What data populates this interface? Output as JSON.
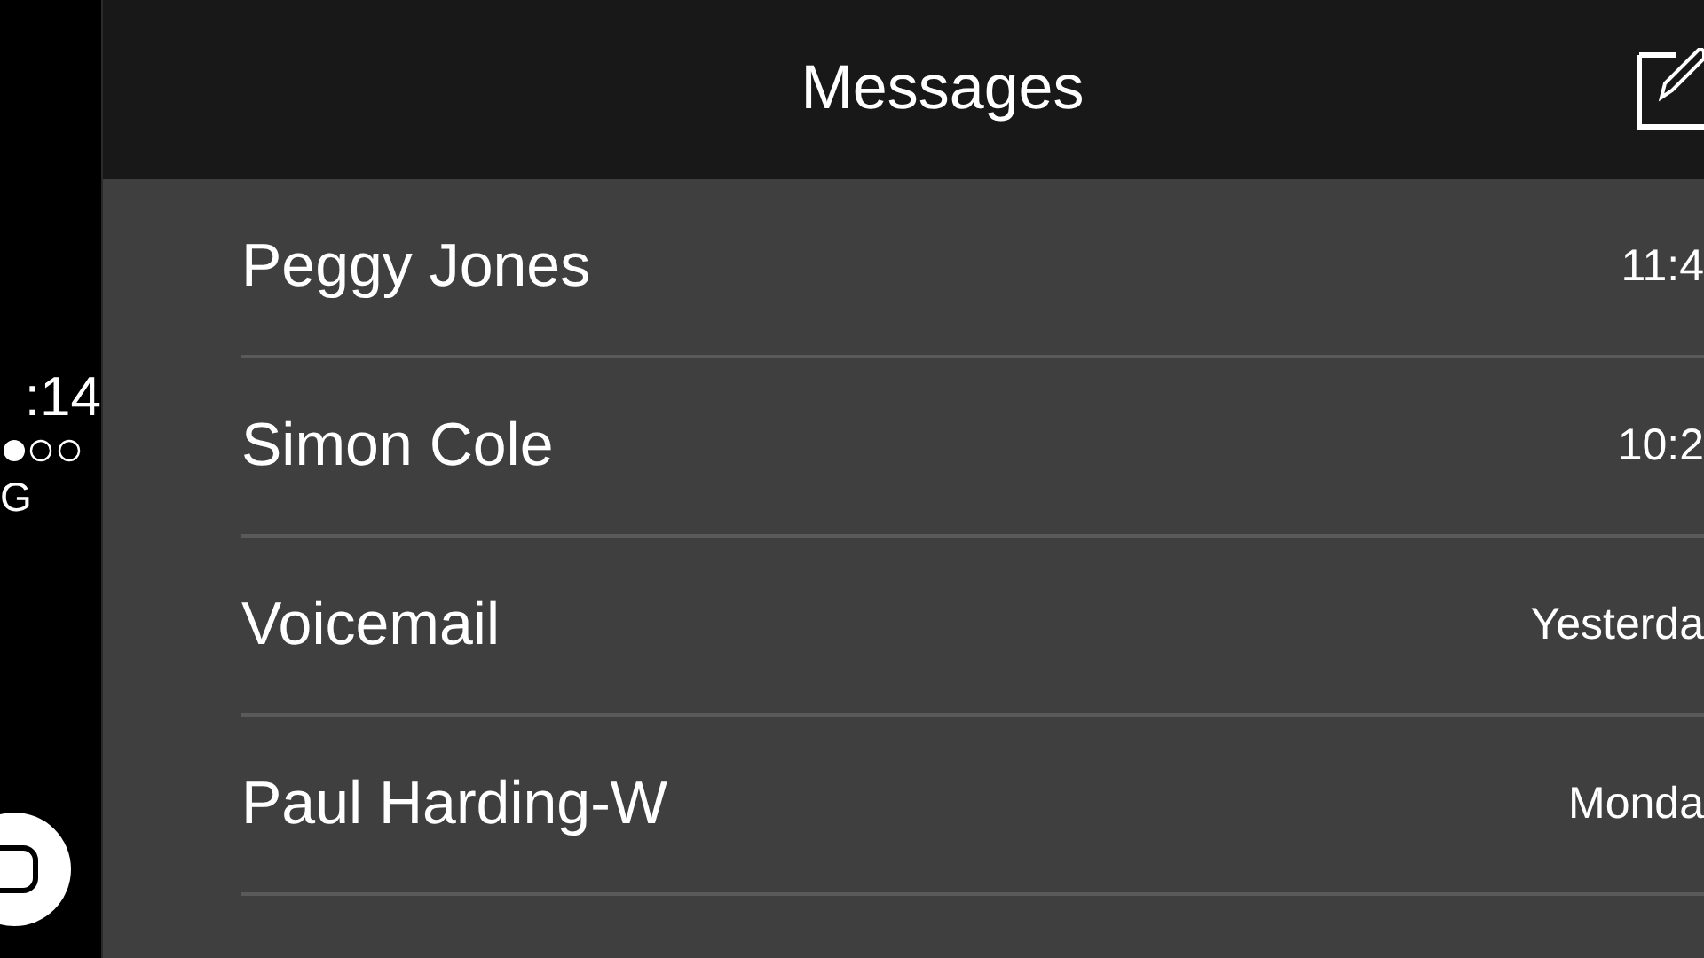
{
  "status": {
    "time": ":14",
    "network": "G"
  },
  "header": {
    "title": "Messages"
  },
  "conversations": [
    {
      "name": "Peggy Jones",
      "time": "11:4"
    },
    {
      "name": "Simon Cole",
      "time": "10:2"
    },
    {
      "name": "Voicemail",
      "time": "Yesterda"
    },
    {
      "name": "Paul Harding-W",
      "time": "Monda"
    }
  ]
}
